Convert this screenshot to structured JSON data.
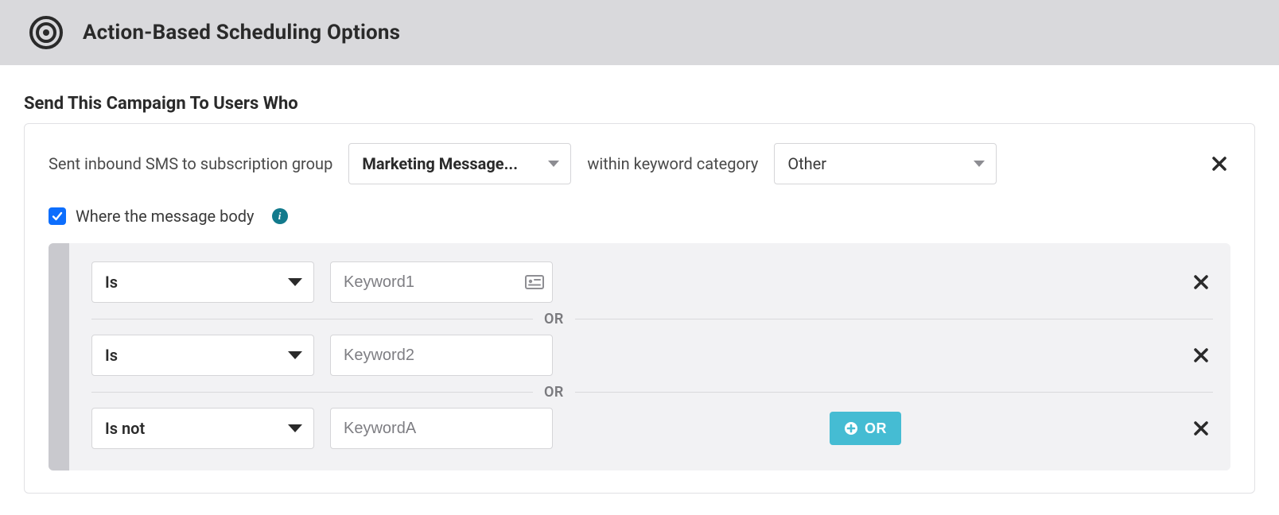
{
  "header": {
    "title": "Action-Based Scheduling Options"
  },
  "section": {
    "title": "Send This Campaign To Users Who"
  },
  "trigger": {
    "prefix": "Sent inbound SMS to subscription group",
    "subscription_group": "Marketing Message...",
    "mid": "within keyword category",
    "keyword_category": "Other"
  },
  "where": {
    "label": "Where the message body",
    "checked": true
  },
  "rules": {
    "conjunction": "OR",
    "rows": [
      {
        "operator": "Is",
        "placeholder": "Keyword1",
        "show_token_icon": true
      },
      {
        "operator": "Is",
        "placeholder": "Keyword2",
        "show_token_icon": false
      },
      {
        "operator": "Is not",
        "placeholder": "KeywordA",
        "show_token_icon": false,
        "show_add_or": true
      }
    ],
    "add_or_label": "OR"
  }
}
